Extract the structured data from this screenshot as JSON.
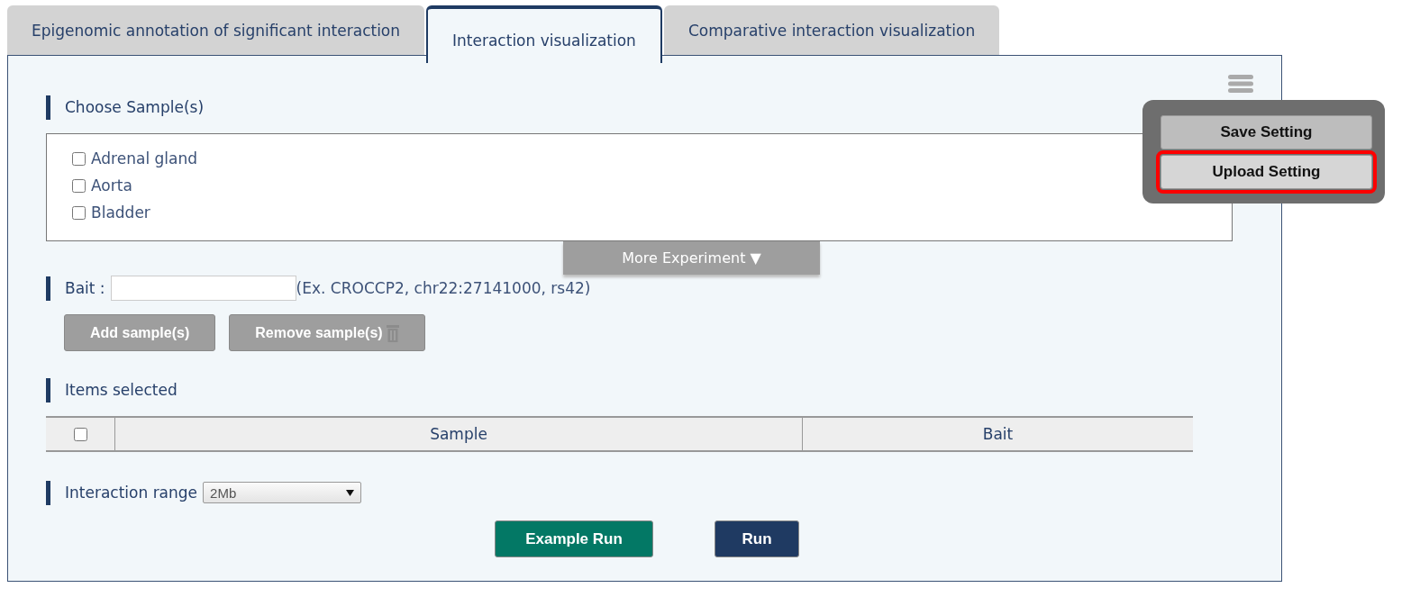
{
  "tabs": [
    {
      "label": "Epigenomic annotation of significant interaction",
      "selected": false
    },
    {
      "label": "Interaction visualization",
      "selected": true
    },
    {
      "label": "Comparative interaction visualization",
      "selected": false
    }
  ],
  "choose_samples": {
    "heading": "Choose Sample(s)",
    "options": [
      {
        "label": "Adrenal gland",
        "checked": false
      },
      {
        "label": "Aorta",
        "checked": false
      },
      {
        "label": "Bladder",
        "checked": false
      }
    ],
    "more_button": "More Experiment ▼"
  },
  "bait": {
    "label": "Bait :",
    "hint": "(Ex. CROCCP2, chr22:27141000, rs42)",
    "add_button": "Add sample(s)",
    "remove_button": "Remove sample(s)"
  },
  "items_selected": {
    "heading": "Items selected",
    "select_all_checked": false,
    "columns": [
      "Sample",
      "Bait"
    ]
  },
  "interaction_range": {
    "label": "Interaction range",
    "value": "2Mb"
  },
  "actions": [
    "Example Run",
    "Run"
  ],
  "settings_menu": {
    "items": [
      {
        "label": "Save Setting",
        "highlighted": false
      },
      {
        "label": "Upload Setting",
        "highlighted": true
      }
    ]
  }
}
